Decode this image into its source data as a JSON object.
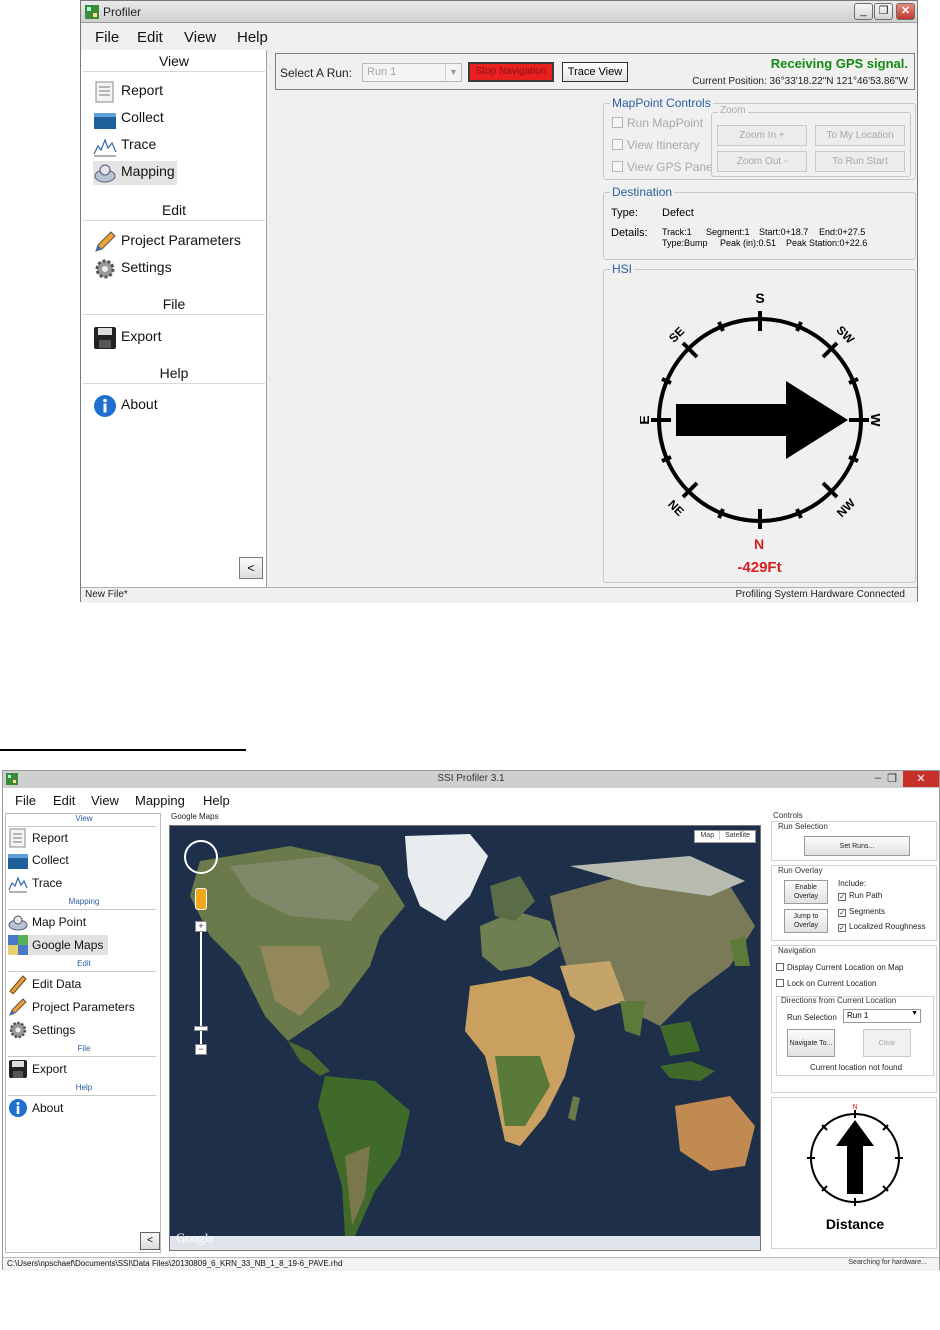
{
  "window1": {
    "title": "Profiler",
    "menu": [
      "File",
      "Edit",
      "View",
      "Help"
    ],
    "sidebar": {
      "view_header": "View",
      "view_items": [
        "Report",
        "Collect",
        "Trace",
        "Mapping"
      ],
      "edit_header": "Edit",
      "edit_items": [
        "Project Parameters",
        "Settings"
      ],
      "file_header": "File",
      "file_items": [
        "Export"
      ],
      "help_header": "Help",
      "help_items": [
        "About"
      ],
      "collapse_label": "<"
    },
    "toolbar": {
      "select_run_label": "Select A Run:",
      "run_value": "Run 1",
      "stop_navigation": "Stop Navigation",
      "trace_view": "Trace View",
      "gps_status": "Receiving GPS signal.",
      "current_position": "Current Position: 36°33'18.22\"N   121°46'53.86\"W"
    },
    "mappoint": {
      "title": "MapPoint Controls",
      "options": [
        "Run MapPoint",
        "View Itinerary",
        "View GPS Pane"
      ],
      "zoom_title": "Zoom",
      "zoom_in": "Zoom In +",
      "zoom_out": "Zoom Out -",
      "to_my_location": "To My Location",
      "to_run_start": "To Run Start"
    },
    "destination": {
      "title": "Destination",
      "type_label": "Type:",
      "type_value": "Defect",
      "details_label": "Details:",
      "track": "Track:1",
      "segment": "Segment:1",
      "start": "Start:0+18.7",
      "end": "End:0+27.5",
      "type_bump": "Type:Bump",
      "peak": "Peak (in):0.51",
      "peak_station": "Peak Station:0+22.6"
    },
    "hsi": {
      "title": "HSI",
      "labels": {
        "S": "S",
        "SW": "SW",
        "W": "W",
        "NW": "NW",
        "N": "N",
        "NE": "NE",
        "E": "E",
        "SE": "SE"
      },
      "distance": "-429Ft",
      "heading_color": "#d42020"
    },
    "status": {
      "left": "New File*",
      "right": "Profiling System Hardware Connected"
    }
  },
  "window2": {
    "title": "SSI Profiler 3.1",
    "menu": [
      "File",
      "Edit",
      "View",
      "Mapping",
      "Help"
    ],
    "sidebar": {
      "view_header": "View",
      "view_items": [
        "Report",
        "Collect",
        "Trace"
      ],
      "mapping_header": "Mapping",
      "mapping_items": [
        "Map Point",
        "Google Maps"
      ],
      "edit_header": "Edit",
      "edit_items": [
        "Edit Data",
        "Project Parameters",
        "Settings"
      ],
      "file_header": "File",
      "file_items": [
        "Export"
      ],
      "help_header": "Help",
      "help_items": [
        "About"
      ],
      "collapse_label": "<"
    },
    "map": {
      "label": "Google Maps",
      "type_map": "Map",
      "type_satellite": "Satellite",
      "logo": "Google"
    },
    "controls": {
      "title": "Controls",
      "run_selection_title": "Run Selection",
      "set_runs": "Set Runs...",
      "run_overlay_title": "Run Overlay",
      "enable_overlay": "Enable Overlay",
      "jump_to_overlay": "Jump to Overlay",
      "include_label": "Include:",
      "include_options": [
        "Run Path",
        "Segments",
        "Localized Roughness"
      ],
      "navigation_title": "Navigation",
      "display_current_location": "Display Current Location on Map",
      "lock_on_current_location": "Lock on Current Location",
      "directions_title": "Directions from Current Location",
      "run_selection_label": "Run Selection",
      "run_value": "Run 1",
      "navigate_to": "Navigate To...",
      "clear": "Clear",
      "location_status": "Current location not found",
      "compass_distance": "Distance"
    },
    "status": {
      "left": "C:\\Users\\npschaef\\Documents\\SSI\\Data Files\\20130809_6_KRN_33_NB_1_8_19-6_PAVE.rhd",
      "right": "Searching for hardware..."
    }
  }
}
